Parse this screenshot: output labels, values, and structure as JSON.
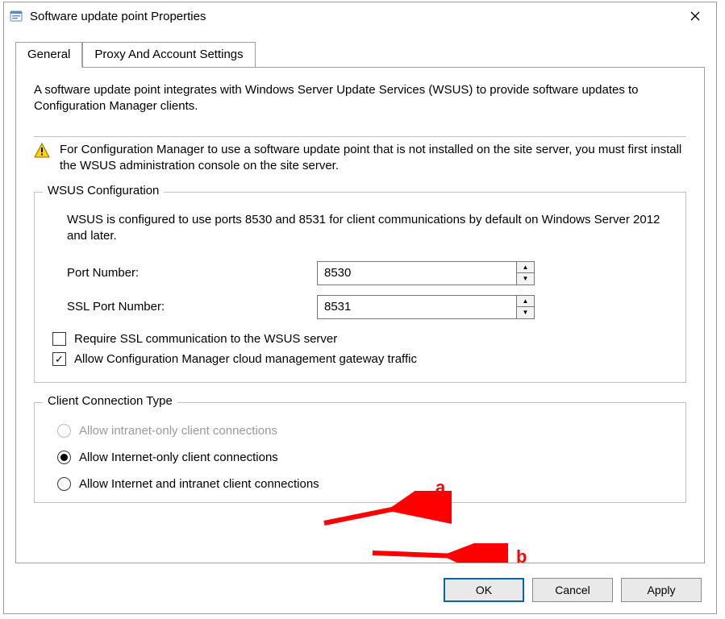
{
  "window": {
    "title": "Software update point Properties"
  },
  "tabs": {
    "general": "General",
    "proxy": "Proxy And Account Settings"
  },
  "intro": "A software update point integrates with Windows Server Update Services (WSUS) to provide software updates to Configuration Manager clients.",
  "warning": "For Configuration Manager to use a software update point that is not installed on the site server, you must first install the WSUS administration console on the site server.",
  "wsus": {
    "legend": "WSUS Configuration",
    "desc": "WSUS is configured to use ports 8530 and 8531 for client communications by default on Windows Server 2012 and later.",
    "port_label": "Port Number:",
    "port_value": "8530",
    "ssl_port_label": "SSL Port Number:",
    "ssl_port_value": "8531",
    "require_ssl_label": "Require SSL communication to the WSUS server",
    "require_ssl_checked": false,
    "allow_cmg_label": "Allow Configuration Manager cloud management gateway traffic",
    "allow_cmg_checked": true
  },
  "conn": {
    "legend": "Client Connection Type",
    "opt_intranet": "Allow intranet-only client connections",
    "opt_internet": "Allow Internet-only client connections",
    "opt_both": "Allow Internet and intranet client connections",
    "intranet_enabled": false,
    "selected": "internet"
  },
  "buttons": {
    "ok": "OK",
    "cancel": "Cancel",
    "apply": "Apply"
  },
  "annotations": {
    "a": "a",
    "b": "b"
  }
}
